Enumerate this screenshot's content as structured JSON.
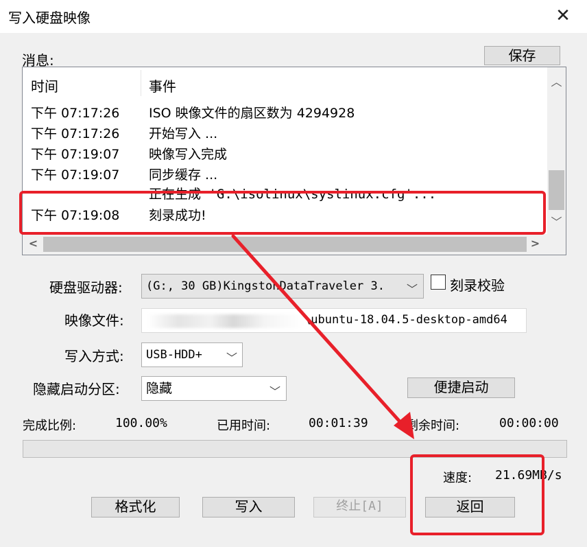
{
  "window": {
    "title": "写入硬盘映像",
    "close_glyph": "✕"
  },
  "messages": {
    "label": "消息:",
    "save_button": "保存",
    "columns": {
      "time": "时间",
      "event": "事件"
    },
    "rows": [
      {
        "time": "下午 07:17:26",
        "event": "ISO 映像文件的扇区数为 4294928"
      },
      {
        "time": "下午 07:17:26",
        "event": "开始写入 ..."
      },
      {
        "time": "下午 07:19:07",
        "event": "映像写入完成"
      },
      {
        "time": "下午 07:19:07",
        "event": "同步缓存 ..."
      },
      {
        "time": "",
        "event": "正在生成 'G:\\isolinux\\syslinux.cfg'..."
      },
      {
        "time": "下午 07:19:08",
        "event": "刻录成功!"
      }
    ],
    "scroll_up": "︿",
    "scroll_down": "﹀",
    "scroll_left": "<",
    "scroll_right": ">"
  },
  "form": {
    "drive_label": "硬盘驱动器:",
    "drive_value": "(G:, 30 GB)KingstonDataTraveler 3.",
    "verify_label": "刻录校验",
    "verify_checked": false,
    "image_label": "映像文件:",
    "image_value": "\\ubuntu-18.04.5-desktop-amd64",
    "write_mode_label": "写入方式:",
    "write_mode_value": "USB-HDD+",
    "hidden_partition_label": "隐藏启动分区:",
    "hidden_partition_value": "隐藏",
    "quick_boot_button": "便捷启动"
  },
  "status": {
    "progress_label": "完成比例:",
    "progress_value": "100.00%",
    "elapsed_label": "已用时间:",
    "elapsed_value": "00:01:39",
    "remaining_label": "剩余时间:",
    "remaining_value": "00:00:00",
    "speed_label": "速度:",
    "speed_value": "21.69MB/s",
    "progress_fraction": 1.0
  },
  "buttons": {
    "format": "格式化",
    "write": "写入",
    "stop": "终止[A]",
    "back": "返回"
  },
  "colors": {
    "annotation_red": "#e8202a",
    "dialog_bg": "#f0f0f0",
    "button_bg": "#e1e1e1"
  }
}
